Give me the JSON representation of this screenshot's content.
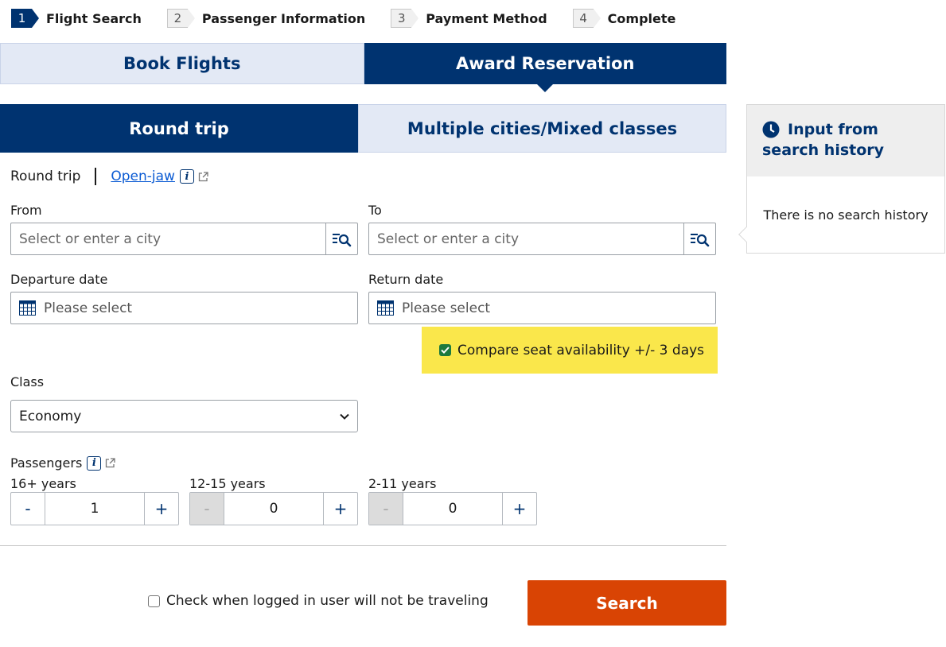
{
  "steps": [
    {
      "num": "1",
      "label": "Flight Search"
    },
    {
      "num": "2",
      "label": "Passenger Information"
    },
    {
      "num": "3",
      "label": "Payment Method"
    },
    {
      "num": "4",
      "label": "Complete"
    }
  ],
  "main_tabs": {
    "book": "Book Flights",
    "award": "Award Reservation"
  },
  "trip_tabs": {
    "round": "Round trip",
    "multi": "Multiple cities/Mixed classes"
  },
  "trip_type": {
    "current": "Round trip",
    "openjaw": "Open-jaw"
  },
  "from": {
    "label": "From",
    "placeholder": "Select or enter a city"
  },
  "to": {
    "label": "To",
    "placeholder": "Select or enter a city"
  },
  "departure": {
    "label": "Departure date",
    "placeholder": "Please select"
  },
  "return_date": {
    "label": "Return date",
    "placeholder": "Please select"
  },
  "compare": {
    "label": "Compare seat availability +/- 3 days",
    "checked": true
  },
  "class": {
    "label": "Class",
    "value": "Economy"
  },
  "passengers": {
    "label": "Passengers",
    "groups": [
      {
        "label": "16+ years",
        "minus": "-",
        "value": "1",
        "plus": "+"
      },
      {
        "label": "12-15 years",
        "minus": "-",
        "value": "0",
        "plus": "+"
      },
      {
        "label": "2-11 years",
        "minus": "-",
        "value": "0",
        "plus": "+"
      }
    ]
  },
  "not_traveling": {
    "label": "Check when logged in user will not be traveling",
    "checked": false
  },
  "search_button": "Search",
  "history": {
    "title_line1": "Input from",
    "title_line2": "search history",
    "empty": "There is no search history"
  },
  "colors": {
    "navy": "#003370",
    "tab_light": "#e3e9f5",
    "search_orange": "#d94404",
    "highlight_yellow": "#fae74b",
    "check_green": "#1c7a3e",
    "link_blue": "#0b5bd3"
  }
}
